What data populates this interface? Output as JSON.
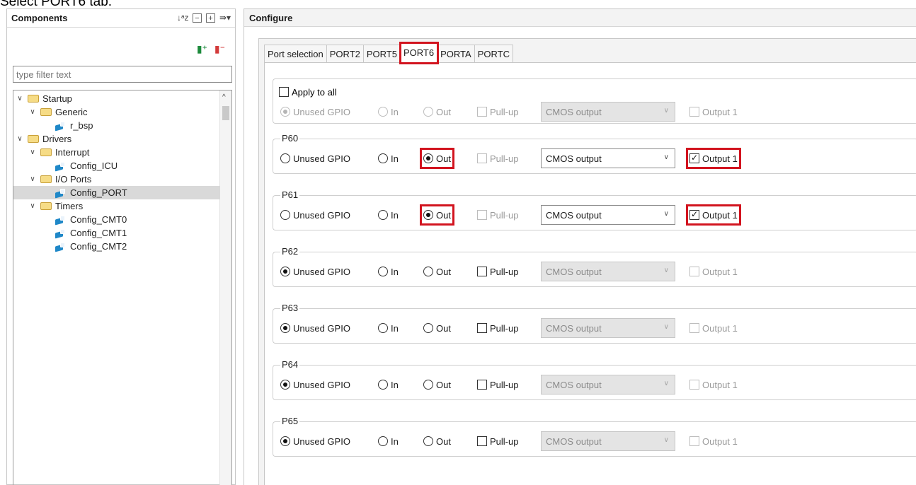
{
  "caption": "Select PORT6 tab.",
  "components_panel": {
    "title": "Components",
    "filter_placeholder": "type filter text",
    "tree": [
      {
        "label": "Startup",
        "level": 0,
        "type": "folder",
        "expanded": true
      },
      {
        "label": "Generic",
        "level": 1,
        "type": "folder",
        "expanded": true
      },
      {
        "label": "r_bsp",
        "level": 2,
        "type": "component"
      },
      {
        "label": "Drivers",
        "level": 0,
        "type": "folder",
        "expanded": true
      },
      {
        "label": "Interrupt",
        "level": 1,
        "type": "folder",
        "expanded": true
      },
      {
        "label": "Config_ICU",
        "level": 2,
        "type": "component"
      },
      {
        "label": "I/O Ports",
        "level": 1,
        "type": "folder",
        "expanded": true
      },
      {
        "label": "Config_PORT",
        "level": 2,
        "type": "component",
        "selected": true
      },
      {
        "label": "Timers",
        "level": 1,
        "type": "folder",
        "expanded": true
      },
      {
        "label": "Config_CMT0",
        "level": 2,
        "type": "component"
      },
      {
        "label": "Config_CMT1",
        "level": 2,
        "type": "component"
      },
      {
        "label": "Config_CMT2",
        "level": 2,
        "type": "component"
      }
    ]
  },
  "configure_panel": {
    "title": "Configure",
    "tabs": [
      {
        "label": "Port selection",
        "active": false
      },
      {
        "label": "PORT2",
        "active": false
      },
      {
        "label": "PORT5",
        "active": false
      },
      {
        "label": "PORT6",
        "active": true
      },
      {
        "label": "PORTA",
        "active": false
      },
      {
        "label": "PORTC",
        "active": false
      }
    ],
    "apply_all": {
      "label": "Apply to all",
      "checked": false,
      "row": {
        "unused": "Unused GPIO",
        "in": "In",
        "out": "Out",
        "pullup": "Pull-up",
        "select": "CMOS output",
        "output1": "Output 1"
      }
    },
    "pins": [
      {
        "name": "P60",
        "unused": "Unused GPIO",
        "in": "In",
        "out": "Out",
        "pullup": "Pull-up",
        "select": "CMOS output",
        "output1": "Output 1",
        "mode": "out",
        "output1_checked": true
      },
      {
        "name": "P61",
        "unused": "Unused GPIO",
        "in": "In",
        "out": "Out",
        "pullup": "Pull-up",
        "select": "CMOS output",
        "output1": "Output 1",
        "mode": "out",
        "output1_checked": true
      },
      {
        "name": "P62",
        "unused": "Unused GPIO",
        "in": "In",
        "out": "Out",
        "pullup": "Pull-up",
        "select": "CMOS output",
        "output1": "Output 1",
        "mode": "unused",
        "output1_checked": false
      },
      {
        "name": "P63",
        "unused": "Unused GPIO",
        "in": "In",
        "out": "Out",
        "pullup": "Pull-up",
        "select": "CMOS output",
        "output1": "Output 1",
        "mode": "unused",
        "output1_checked": false
      },
      {
        "name": "P64",
        "unused": "Unused GPIO",
        "in": "In",
        "out": "Out",
        "pullup": "Pull-up",
        "select": "CMOS output",
        "output1": "Output 1",
        "mode": "unused",
        "output1_checked": false
      },
      {
        "name": "P65",
        "unused": "Unused GPIO",
        "in": "In",
        "out": "Out",
        "pullup": "Pull-up",
        "select": "CMOS output",
        "output1": "Output 1",
        "mode": "unused",
        "output1_checked": false
      }
    ]
  },
  "colors": {
    "highlight": "#d2141f",
    "selection": "#d9d9d9",
    "component_icon": "#1f88c8",
    "folder_icon": "#f6dc86"
  }
}
